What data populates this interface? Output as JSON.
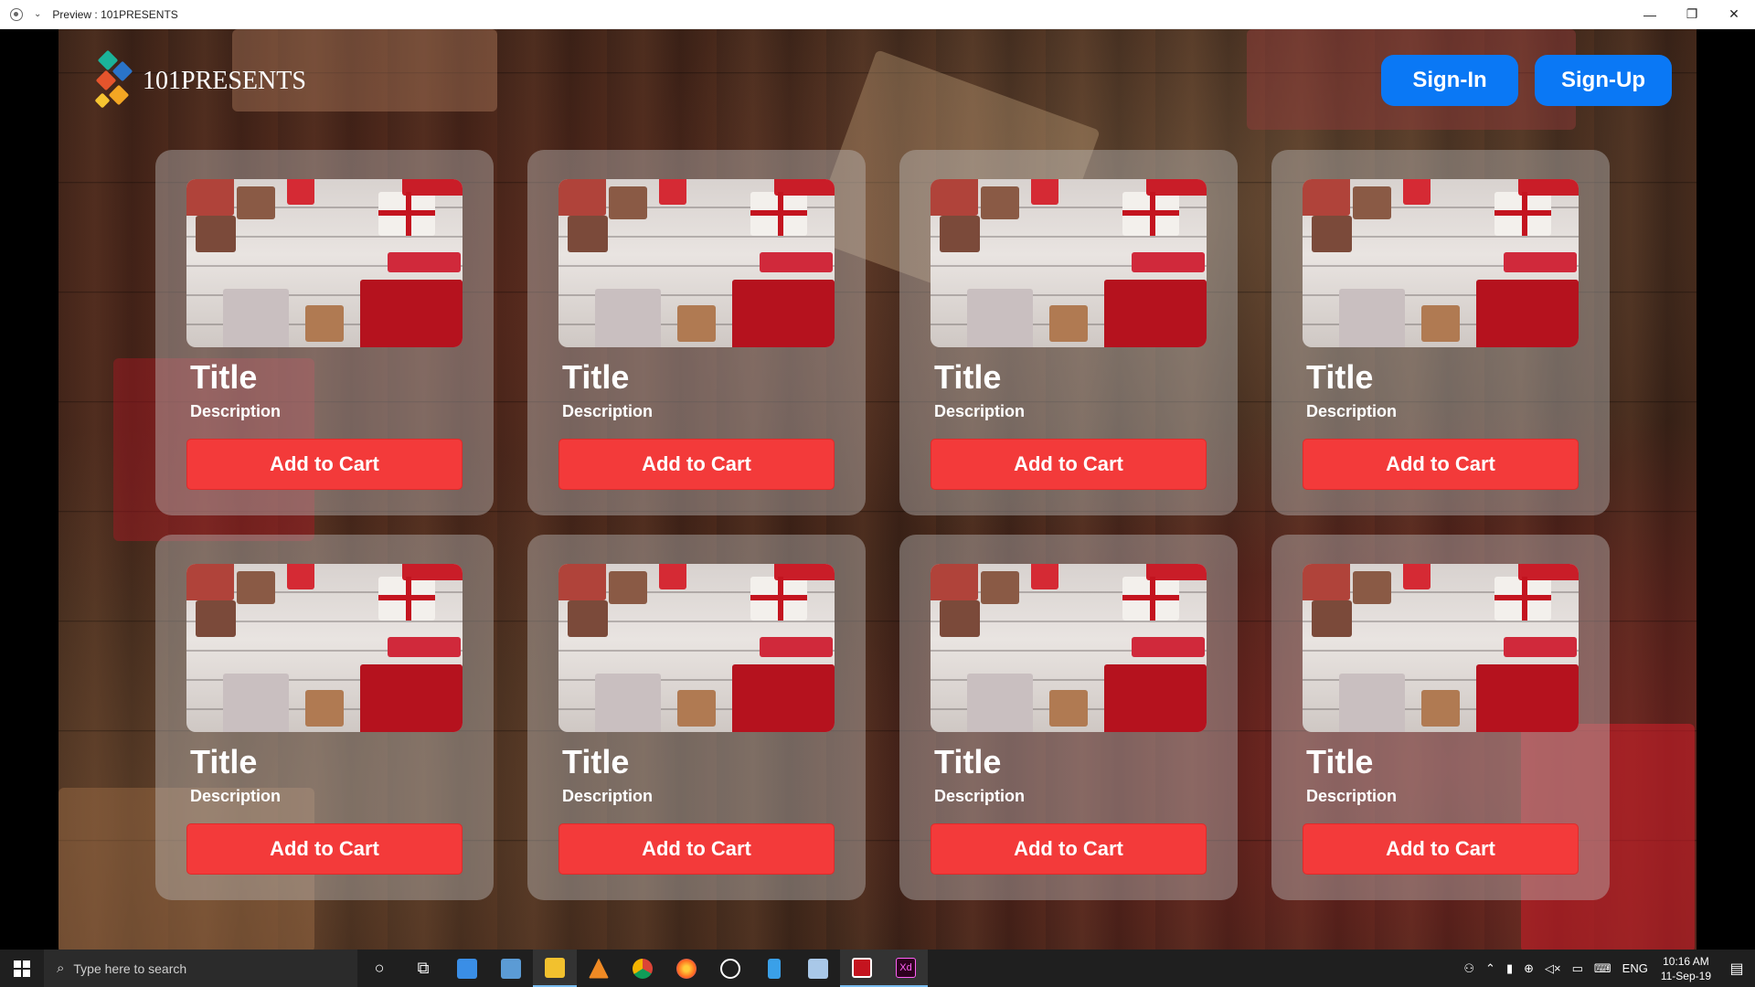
{
  "window": {
    "title": "Preview : 101PRESENTS",
    "minimize_glyph": "—",
    "restore_glyph": "❐",
    "close_glyph": "✕"
  },
  "header": {
    "logo_text": "101PRESENTS",
    "signin_label": "Sign-In",
    "signup_label": "Sign-Up"
  },
  "products": [
    {
      "title": "Title",
      "description": "Description",
      "button": "Add to Cart"
    },
    {
      "title": "Title",
      "description": "Description",
      "button": "Add to Cart"
    },
    {
      "title": "Title",
      "description": "Description",
      "button": "Add to Cart"
    },
    {
      "title": "Title",
      "description": "Description",
      "button": "Add to Cart"
    },
    {
      "title": "Title",
      "description": "Description",
      "button": "Add to Cart"
    },
    {
      "title": "Title",
      "description": "Description",
      "button": "Add to Cart"
    },
    {
      "title": "Title",
      "description": "Description",
      "button": "Add to Cart"
    },
    {
      "title": "Title",
      "description": "Description",
      "button": "Add to Cart"
    }
  ],
  "taskbar": {
    "search_placeholder": "Type here to search",
    "language": "ENG",
    "time": "10:16 AM",
    "date": "11-Sep-19"
  },
  "colors": {
    "accent_blue": "#0a78f5",
    "cart_red": "#f33a3a"
  }
}
